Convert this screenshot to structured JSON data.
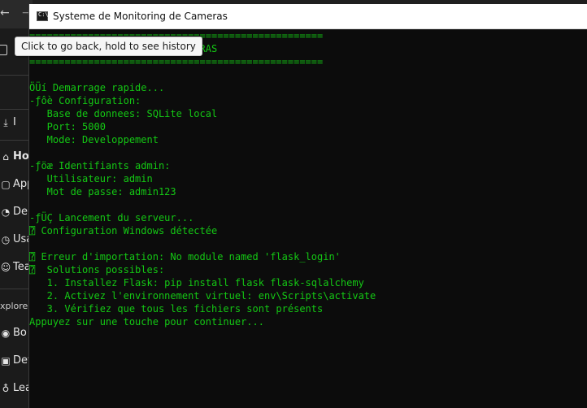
{
  "window": {
    "title": "Systeme de Monitoring de Cameras",
    "icon": "cmd-icon"
  },
  "tooltip": {
    "text": "Click to go back, hold to see history"
  },
  "browser_sidebar": {
    "items": [
      {
        "icon": "download-icon",
        "label": "I"
      },
      {
        "icon": "home-icon",
        "label": "Ho"
      },
      {
        "icon": "apps-icon",
        "label": "App"
      },
      {
        "icon": "deploy-icon",
        "label": "De"
      },
      {
        "icon": "usage-icon",
        "label": "Usa"
      },
      {
        "icon": "team-icon",
        "label": "Tea"
      },
      {
        "icon": "bounties-icon",
        "label": "Bo"
      },
      {
        "icon": "dev-icon",
        "label": "Dev"
      },
      {
        "icon": "learn-icon",
        "label": "Lea"
      }
    ],
    "section_label": "xplore"
  },
  "console": {
    "colors": {
      "text": "#14c814",
      "background": "#0c0c0c"
    },
    "lines": [
      "==================================================",
      "SYSTEME DE MONITORING DE CAMERAS",
      "==================================================",
      "",
      "ÖÜí Demarrage rapide...",
      "-ƒôè Configuration:",
      "   Base de donnees: SQLite local",
      "   Port: 5000",
      "   Mode: Developpement",
      "",
      "-ƒöæ Identifiants admin:",
      "   Utilisateur: admin",
      "   Mot de passe: admin123",
      "",
      "-ƒÜÇ Lancement du serveur...",
      "⍰ Configuration Windows détectée",
      "",
      "⍰ Erreur d'importation: No module named 'flask_login'",
      "⍰  Solutions possibles:",
      "   1. Installez Flask: pip install flask flask-sqlalchemy",
      "   2. Activez l'environnement virtuel: env\\Scripts\\activate",
      "   3. Vérifiez que tous les fichiers sont présents",
      "Appuyez sur une touche pour continuer..."
    ]
  }
}
